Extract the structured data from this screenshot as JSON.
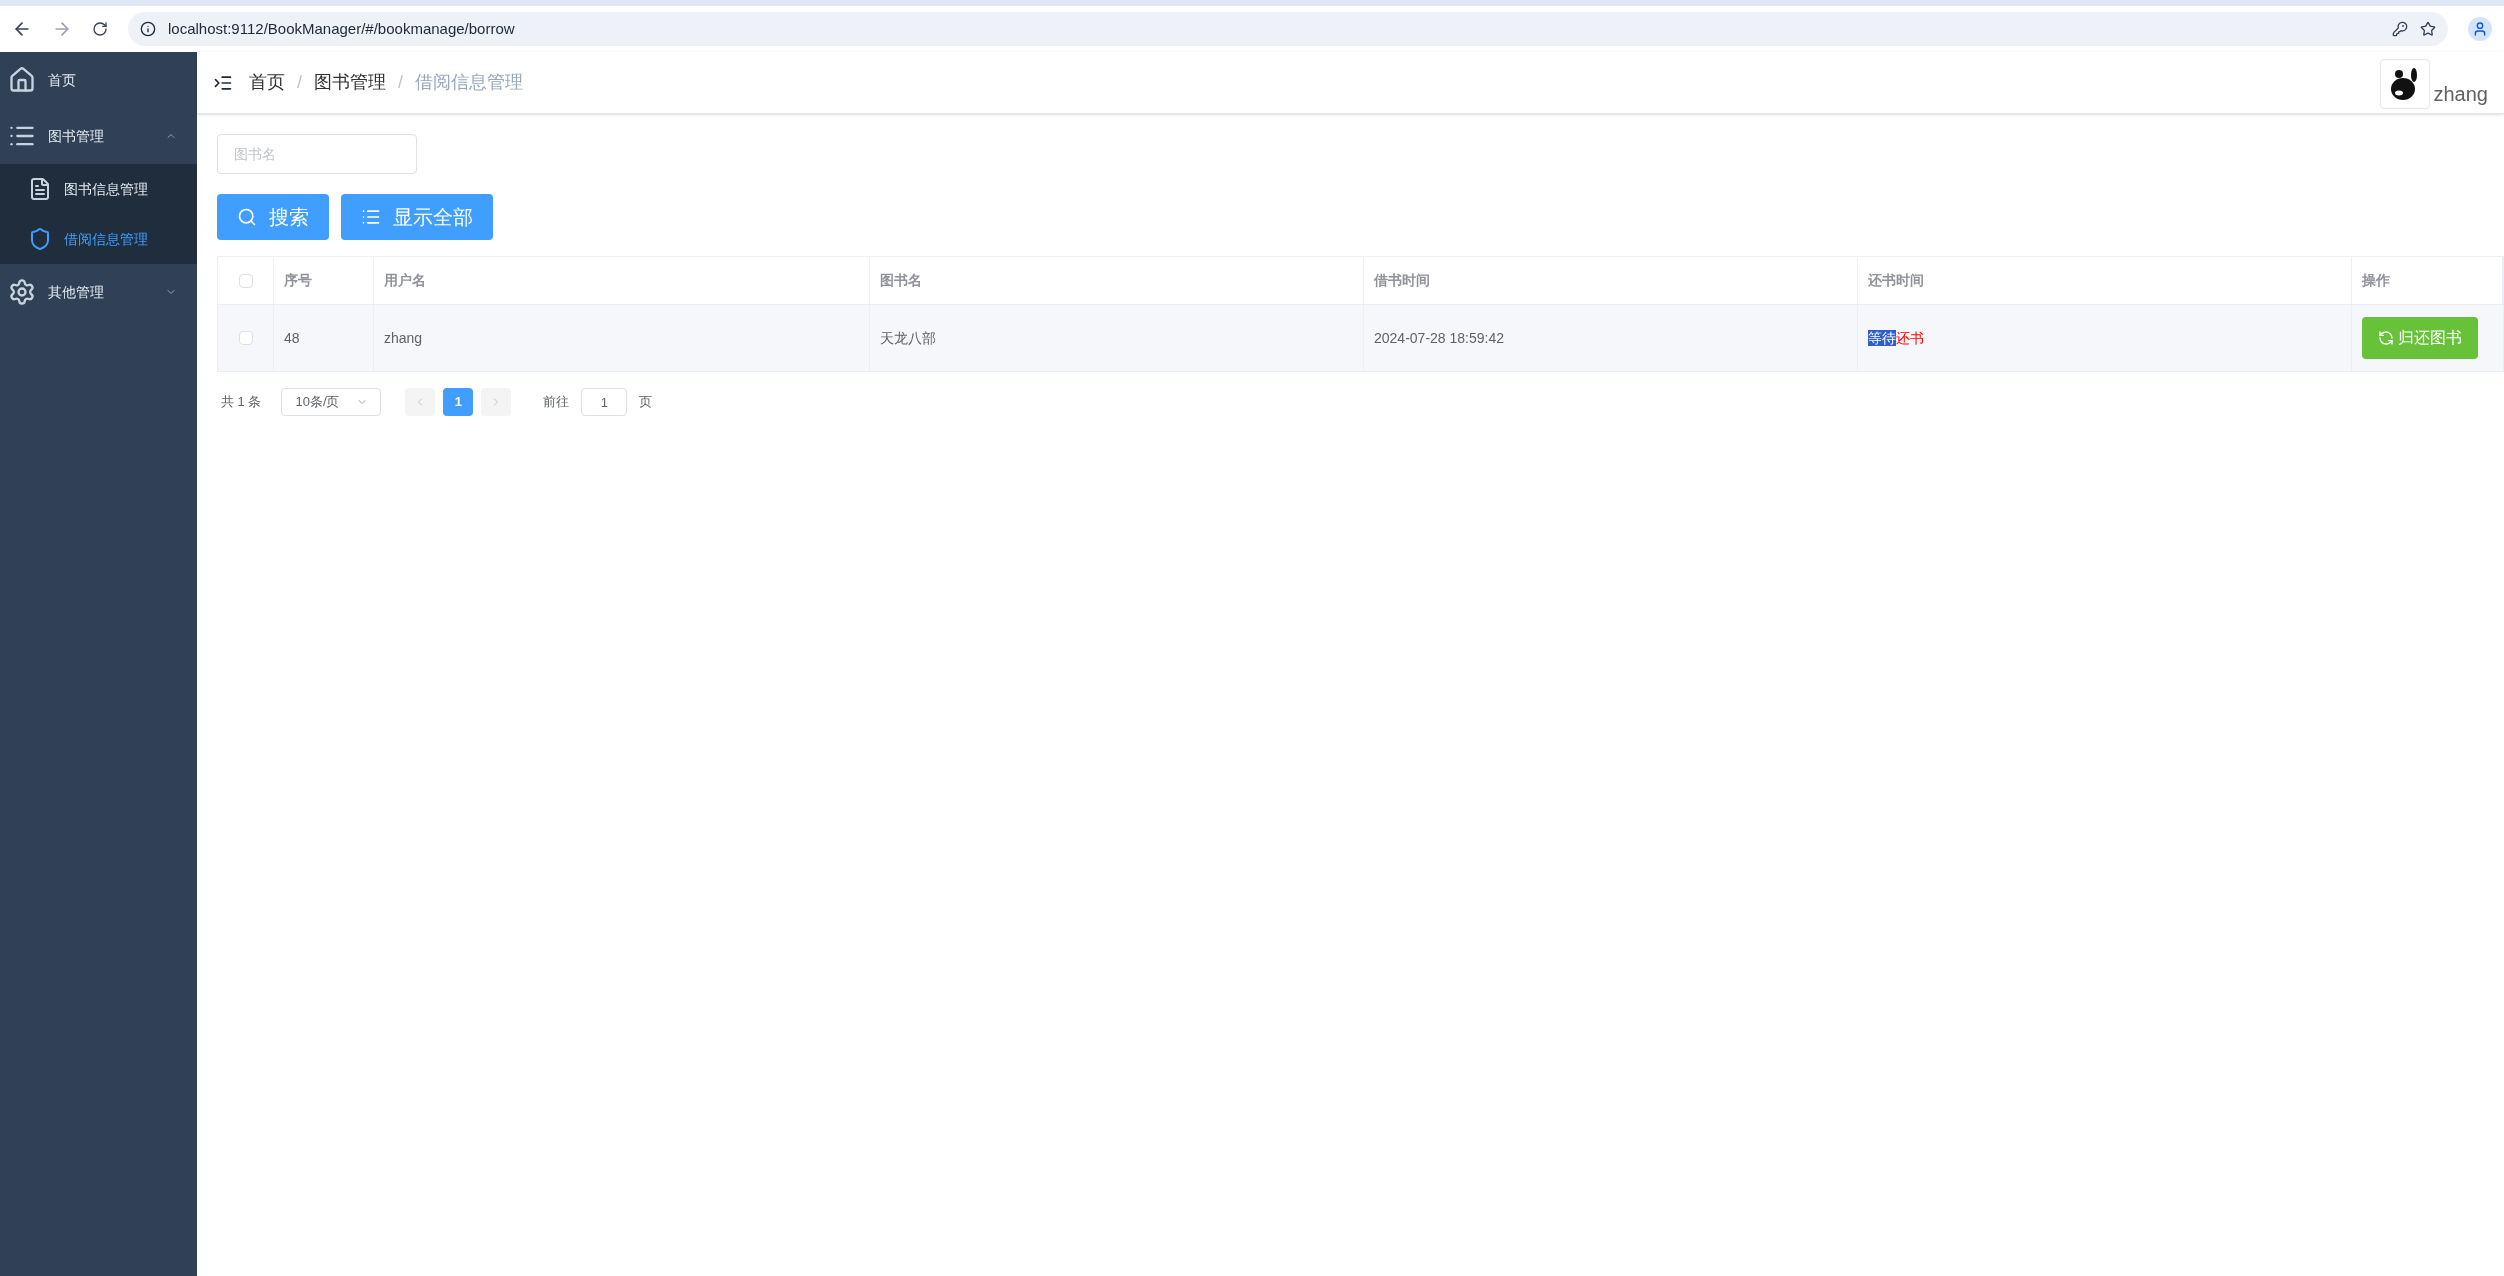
{
  "browser": {
    "url": "localhost:9112/BookManager/#/bookmanage/borrow"
  },
  "sidebar": {
    "items": [
      {
        "label": "首页",
        "kind": "link",
        "selected": false
      },
      {
        "label": "图书管理",
        "kind": "group",
        "expanded": true,
        "children": [
          {
            "label": "图书信息管理",
            "selected": false
          },
          {
            "label": "借阅信息管理",
            "selected": true
          }
        ]
      },
      {
        "label": "其他管理",
        "kind": "group",
        "expanded": false
      }
    ]
  },
  "header": {
    "breadcrumb": [
      {
        "label": "首页",
        "current": false
      },
      {
        "separator": "/",
        "label": "图书管理",
        "current": false
      },
      {
        "separator": "/",
        "label": "借阅信息管理",
        "current": true
      }
    ],
    "username": "zhang"
  },
  "search": {
    "placeholder": "图书名"
  },
  "buttons": [
    {
      "label": "搜索"
    },
    {
      "label": "显示全部"
    }
  ],
  "table": {
    "select_all_checked": false,
    "columns": [
      "序号",
      "用户名",
      "图书名",
      "借书时间",
      "还书时间",
      "操作"
    ],
    "rows": [
      {
        "checked": false,
        "cells": [
          "48",
          "zhang",
          "天龙八部",
          "2024-07-28 18:59:42"
        ],
        "return_status": {
          "highlighted": "等待",
          "rest": "还书"
        },
        "action": "归还图书"
      }
    ]
  },
  "pagination": {
    "total": "共 1 条",
    "page_size": "10条/页",
    "pages": [
      {
        "label": "1",
        "selected": true
      }
    ],
    "goto_label": "前往",
    "goto_value": "1",
    "goto_suffix": "页"
  }
}
